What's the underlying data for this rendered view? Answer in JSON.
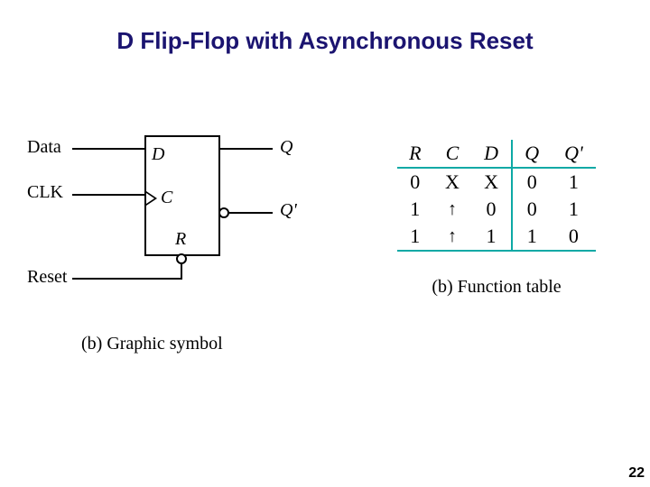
{
  "title": "D Flip-Flop with Asynchronous Reset",
  "page_number": "22",
  "schematic": {
    "external": {
      "data": "Data",
      "clk": "CLK",
      "reset": "Reset"
    },
    "pins": {
      "d": "D",
      "c": "C",
      "r": "R",
      "q": "Q",
      "qn": "Q'"
    },
    "caption": "(b) Graphic symbol"
  },
  "function_table": {
    "caption": "(b) Function table",
    "headers": {
      "r": "R",
      "c": "C",
      "d": "D",
      "q": "Q",
      "qn": "Q'"
    },
    "rows": [
      {
        "r": "0",
        "c": "X",
        "d": "X",
        "q": "0",
        "qn": "1"
      },
      {
        "r": "1",
        "c": "↑",
        "d": "0",
        "q": "0",
        "qn": "1"
      },
      {
        "r": "1",
        "c": "↑",
        "d": "1",
        "q": "1",
        "qn": "0"
      }
    ]
  }
}
